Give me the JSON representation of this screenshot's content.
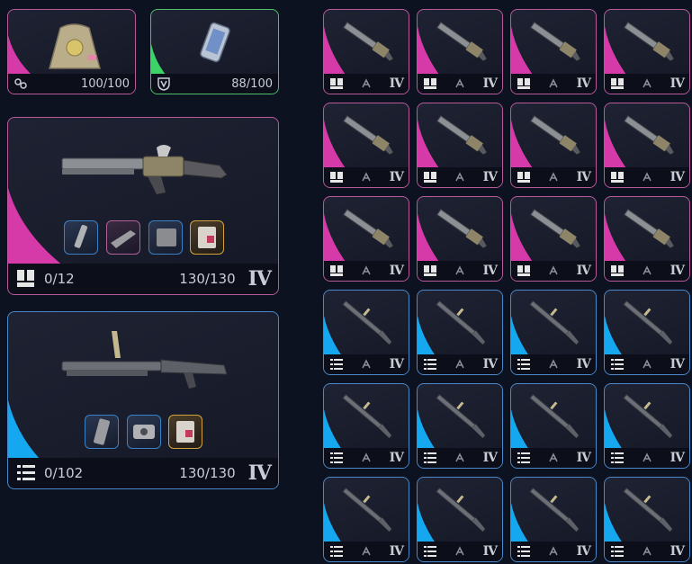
{
  "colors": {
    "pink_accent": "#d63aa8",
    "green_accent": "#3dd368",
    "blue_accent": "#15a8f0",
    "background": "#0d1220"
  },
  "top_items": [
    {
      "icon": "grenade-bundle-icon",
      "count": "100/100",
      "color": "pink"
    },
    {
      "icon": "armor-plate-icon",
      "count": "88/100",
      "color": "green"
    }
  ],
  "primary_weapon": {
    "ammo": "0/12",
    "durability": "130/130",
    "tier": "IV",
    "ammo_icon": "shotgun-shells-icon",
    "attachments": [
      "muzzle-icon",
      "stock-icon",
      "magazine-icon",
      "ammo-box-icon"
    ]
  },
  "secondary_weapon": {
    "ammo": "0/102",
    "durability": "130/130",
    "tier": "IV",
    "ammo_icon": "rifle-ammo-icon",
    "attachments": [
      "magazine-icon",
      "optic-icon",
      "ammo-box-icon"
    ]
  },
  "inventory_grid": {
    "shotgun_tier": "IV",
    "rifle_tier": "IV"
  }
}
